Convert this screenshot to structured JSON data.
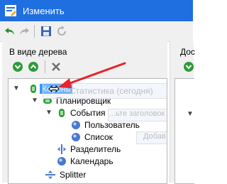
{
  "window": {
    "title": "Изменить"
  },
  "left_panel": {
    "title": "В виде дерева"
  },
  "right_panel": {
    "title": "Дос"
  },
  "tree": {
    "root": "Корень",
    "planner": "Планировщик",
    "events": "События",
    "user": "Пользователь",
    "list": "Список",
    "separator": "Разделитель",
    "calendar": "Календарь",
    "splitter": "Splitter"
  },
  "drag_ghost": {
    "stats": "Статистика (сегодня)",
    "header_hint": "...ьте заголовок",
    "add_hint": "Добав"
  },
  "colors": {
    "title_bar": "#1f6fe0",
    "selection": "#3399ff",
    "arrow": "#e8232a"
  }
}
